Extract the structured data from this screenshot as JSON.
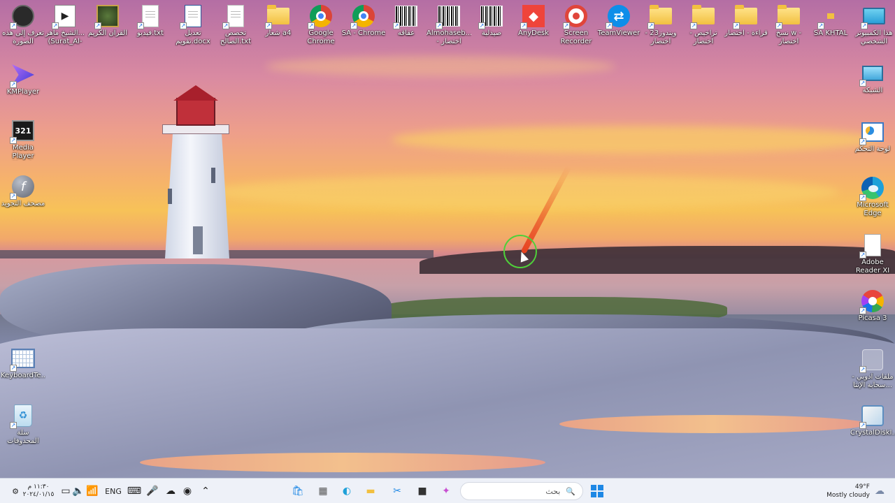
{
  "desktop": {
    "icons_top": [
      {
        "label": "تعرف إلى هذه الصورة",
        "icon": "who-icon"
      },
      {
        "label": "الشيخ ماهر... (Surat_Al-W...",
        "icon": "video-file-icon"
      },
      {
        "label": "القرآن الكريم",
        "icon": "quran-icon"
      },
      {
        "label": "فيديو.txt",
        "icon": "text-file-icon"
      },
      {
        "label": "تعديل تقويم.docx",
        "icon": "word-doc-icon"
      },
      {
        "label": "تخصص الصالح.txt",
        "icon": "text-file-icon"
      },
      {
        "label": "شعار a4",
        "icon": "folder-icon"
      },
      {
        "label": "Google Chrome",
        "icon": "chrome-icon"
      },
      {
        "label": "SA - Chrome",
        "icon": "chrome-icon"
      },
      {
        "label": "عقاقه",
        "icon": "barcode-icon"
      },
      {
        "label": "Almohaseb... - اختصار",
        "icon": "barcode-icon"
      },
      {
        "label": "صيدلية",
        "icon": "barcode-icon"
      },
      {
        "label": "AnyDesk",
        "icon": "anydesk-icon"
      },
      {
        "label": "Screen Recorder",
        "icon": "screen-recorder-icon"
      },
      {
        "label": "TeamViewer",
        "icon": "teamviewer-icon"
      },
      {
        "label": "ويندوز23 - اختصار",
        "icon": "folder-icon"
      },
      {
        "label": "تراخيص - اختصار",
        "icon": "folder-icon"
      },
      {
        "label": "قراءة - اختصار",
        "icon": "folder-icon"
      },
      {
        "label": "نسخ w - اختصار",
        "icon": "folder-icon"
      },
      {
        "label": "SA KHTAL",
        "icon": "small-folder-icon"
      },
      {
        "label": "هذا الكمبيوتر الشخصي",
        "icon": "this-pc-icon"
      }
    ],
    "icons_left": [
      {
        "label": "KMPlayer",
        "icon": "kmplayer-icon"
      },
      {
        "label": "Media Player Classic",
        "icon": "media-player-classic-icon"
      },
      {
        "label": "مصحف التجويد",
        "icon": "flash-icon"
      },
      {
        "label": "KeyboardTe...",
        "icon": "keyboard-icon"
      },
      {
        "label": "سلة المحذوفات",
        "icon": "recycle-bin-icon"
      }
    ],
    "icons_right": [
      {
        "label": "الشبكة",
        "icon": "network-icon"
      },
      {
        "label": "لوحة التحكم",
        "icon": "control-panel-icon"
      },
      {
        "label": "Microsoft Edge",
        "icon": "edge-icon"
      },
      {
        "label": "Adobe Reader XI",
        "icon": "pdf-icon"
      },
      {
        "label": "Picasa 3",
        "icon": "picasa-icon"
      },
      {
        "label": "ملفات أدوبي - سحابة الإنتا...",
        "icon": "cloud-files-icon"
      },
      {
        "label": "CrystalDiskI...",
        "icon": "crystaldisk-icon"
      }
    ]
  },
  "taskbar": {
    "time": "١١:٣٠ م",
    "date": "٢٠٢٤/٠١/١٥",
    "language": "ENG",
    "search_placeholder": "بحث",
    "weather_temp": "49°F",
    "weather_desc": "Mostly cloudy",
    "colors": {
      "accent": "#1e88e5",
      "bar": "#eef1f8"
    }
  }
}
